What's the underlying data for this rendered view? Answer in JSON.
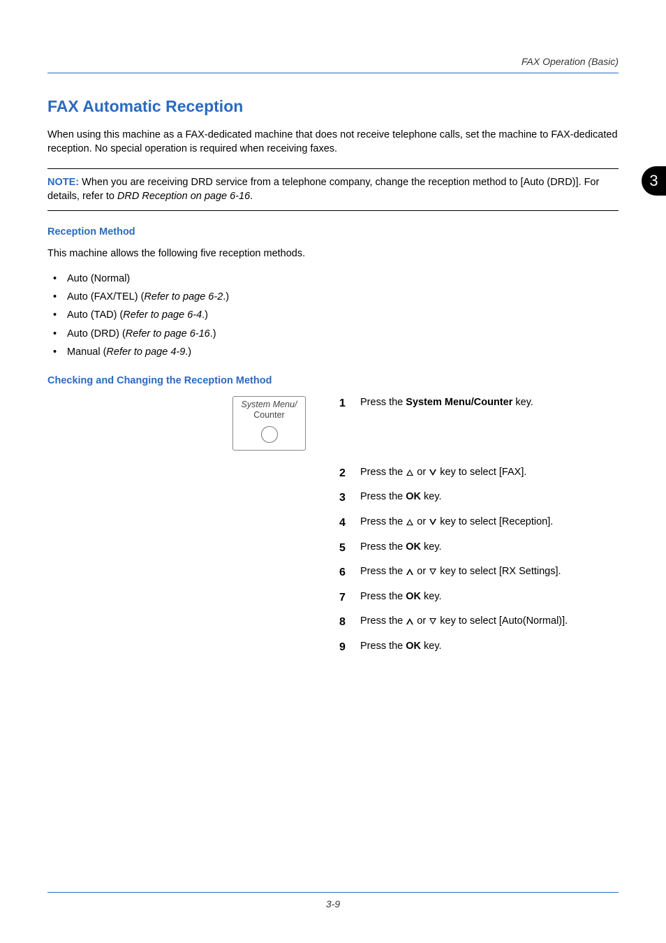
{
  "running_header": "FAX Operation (Basic)",
  "side_tab": "3",
  "h1": "FAX Automatic Reception",
  "intro": "When using this machine as a FAX-dedicated machine that does not receive telephone calls, set the machine to FAX-dedicated reception. No special operation is required when receiving faxes.",
  "note": {
    "label": "NOTE:",
    "text_pre": " When you are receiving DRD service from a telephone company, change the reception method to [Auto (DRD)]. For details, refer to ",
    "ref": "DRD Reception on page 6-16",
    "text_post": "."
  },
  "h2a": "Reception Method",
  "para1": "This machine allows the following five reception methods.",
  "methods": [
    {
      "pre": "Auto (Normal)",
      "ref": "",
      "post": ""
    },
    {
      "pre": "Auto (FAX/TEL) (",
      "ref": "Refer to page 6-2",
      "post": ".)"
    },
    {
      "pre": "Auto (TAD) (",
      "ref": "Refer to page 6-4",
      "post": ".)"
    },
    {
      "pre": "Auto (DRD) (",
      "ref": "Refer to page 6-16",
      "post": ".)"
    },
    {
      "pre": "Manual (",
      "ref": "Refer to page 4-9",
      "post": ".)"
    }
  ],
  "h2b": "Checking and Changing the Reception Method",
  "key_illus": {
    "line1": "System Menu/",
    "line2": "Counter"
  },
  "steps": {
    "s1_a": "Press the ",
    "s1_b": "System Menu/Counter",
    "s1_c": " key.",
    "s2_a": "Press the ",
    "s2_b": " or ",
    "s2_c": " key to select [FAX].",
    "s3_a": "Press the ",
    "s3_b": "OK",
    "s3_c": " key.",
    "s4_a": "Press the ",
    "s4_b": " or ",
    "s4_c": " key to select [Reception].",
    "s5_a": "Press the ",
    "s5_b": "OK",
    "s5_c": " key.",
    "s6_a": "Press the ",
    "s6_b": " or ",
    "s6_c": " key to select [RX Settings].",
    "s7_a": "Press the ",
    "s7_b": "OK",
    "s7_c": " key.",
    "s8_a": "Press the ",
    "s8_b": " or ",
    "s8_c": " key to select [Auto(Normal)].",
    "s9_a": "Press the ",
    "s9_b": "OK",
    "s9_c": " key."
  },
  "page_number": "3-9"
}
